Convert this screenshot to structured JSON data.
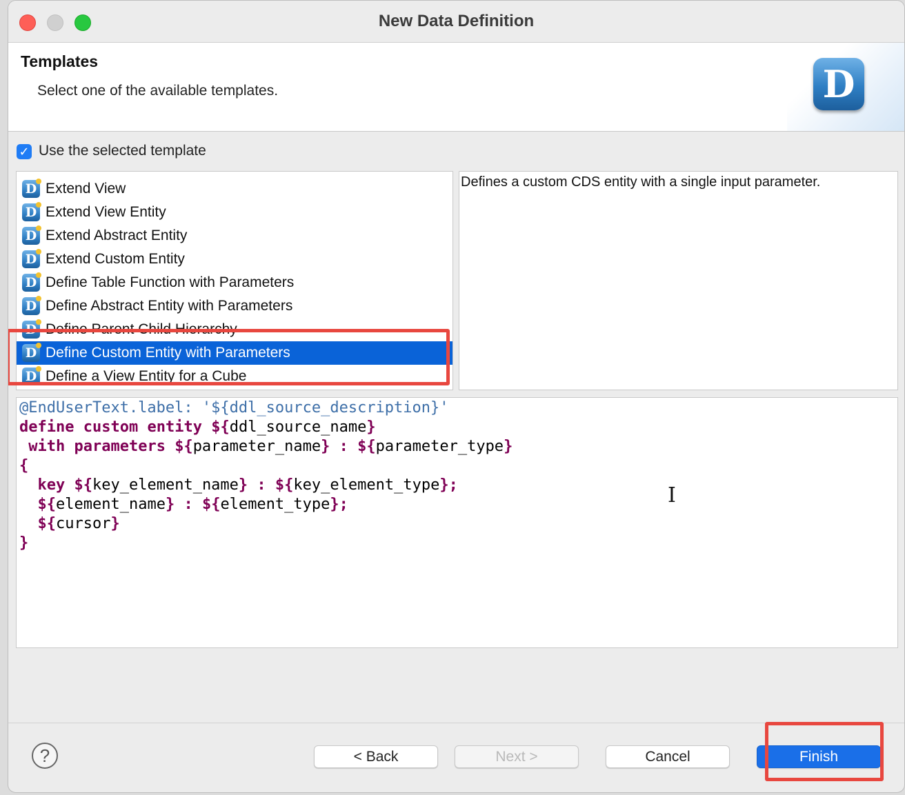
{
  "window": {
    "title": "New Data Definition"
  },
  "header": {
    "title": "Templates",
    "subtitle": "Select one of the available templates.",
    "logo_letter": "D"
  },
  "options": {
    "use_template_label": "Use the selected template",
    "use_template_checked": true
  },
  "templates": {
    "items": [
      {
        "label": "Extend View",
        "selected": false
      },
      {
        "label": "Extend View Entity",
        "selected": false
      },
      {
        "label": "Extend Abstract Entity",
        "selected": false
      },
      {
        "label": "Extend Custom Entity",
        "selected": false
      },
      {
        "label": "Define Table Function with Parameters",
        "selected": false
      },
      {
        "label": "Define Abstract Entity with Parameters",
        "selected": false
      },
      {
        "label": "Define Parent Child Hierarchy",
        "selected": false
      },
      {
        "label": "Define Custom Entity with Parameters",
        "selected": true
      },
      {
        "label": "Define a View Entity for a Cube",
        "selected": false
      }
    ],
    "icon_letter": "D"
  },
  "description": "Defines a custom CDS entity with a single input parameter.",
  "preview": {
    "lines": [
      "@EndUserText.label: '${ddl_source_description}'",
      "define custom entity ${ddl_source_name}",
      " with parameters ${parameter_name} : ${parameter_type}",
      "{",
      "  key ${key_element_name} : ${key_element_type};",
      "  ${element_name} : ${element_type};",
      "  ${cursor}",
      "}"
    ]
  },
  "buttons": {
    "help": "?",
    "back": "< Back",
    "next": "Next >",
    "cancel": "Cancel",
    "finish": "Finish"
  },
  "colors": {
    "selection": "#0a63d8",
    "highlight": "#e8473f",
    "keyword": "#7f0055",
    "annotation": "#3e6fa8",
    "primary_button": "#1a6fe8"
  }
}
